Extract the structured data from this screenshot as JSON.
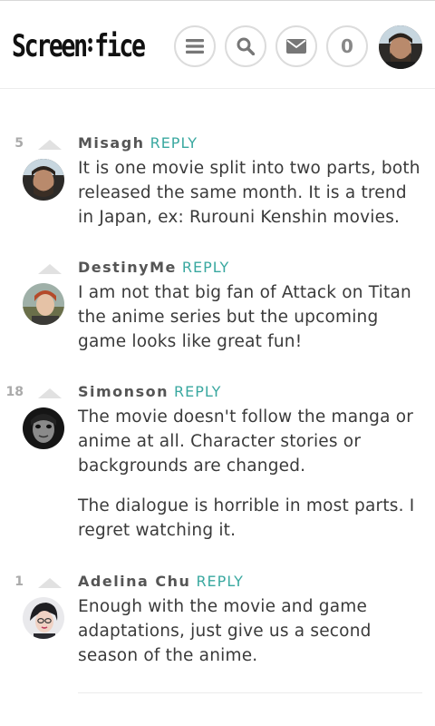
{
  "header": {
    "logo_left": "Screen",
    "logo_right": "fice",
    "notification_count": "0"
  },
  "icons": {
    "menu": "menu-icon",
    "search": "search-icon",
    "mail": "mail-icon"
  },
  "comments": [
    {
      "score": "5",
      "author": "Misagh",
      "reply": "REPLY",
      "paragraphs": [
        "It is one movie split into two parts, both released the same month. It is a trend in Japan, ex: Rurouni Kenshin movies."
      ]
    },
    {
      "score": "",
      "author": "DestinyMe",
      "reply": "REPLY",
      "paragraphs": [
        "I am not that big fan of Attack on Titan the anime series but the upcoming game looks like great fun!"
      ]
    },
    {
      "score": "18",
      "author": "Simonson",
      "reply": "REPLY",
      "paragraphs": [
        "The movie doesn't follow the manga or anime at all. Character stories or backgrounds are changed.",
        "The dialogue is horrible in most parts. I regret watching it."
      ]
    },
    {
      "score": "1",
      "author": "Adelina Chu",
      "reply": "REPLY",
      "paragraphs": [
        "Enough with the movie and game adaptations, just give us a second season of the anime."
      ]
    }
  ],
  "colors": {
    "accent": "#3aa8a0",
    "text": "#3a3a3a",
    "author": "#555555",
    "button_border": "#dcdcdc"
  }
}
